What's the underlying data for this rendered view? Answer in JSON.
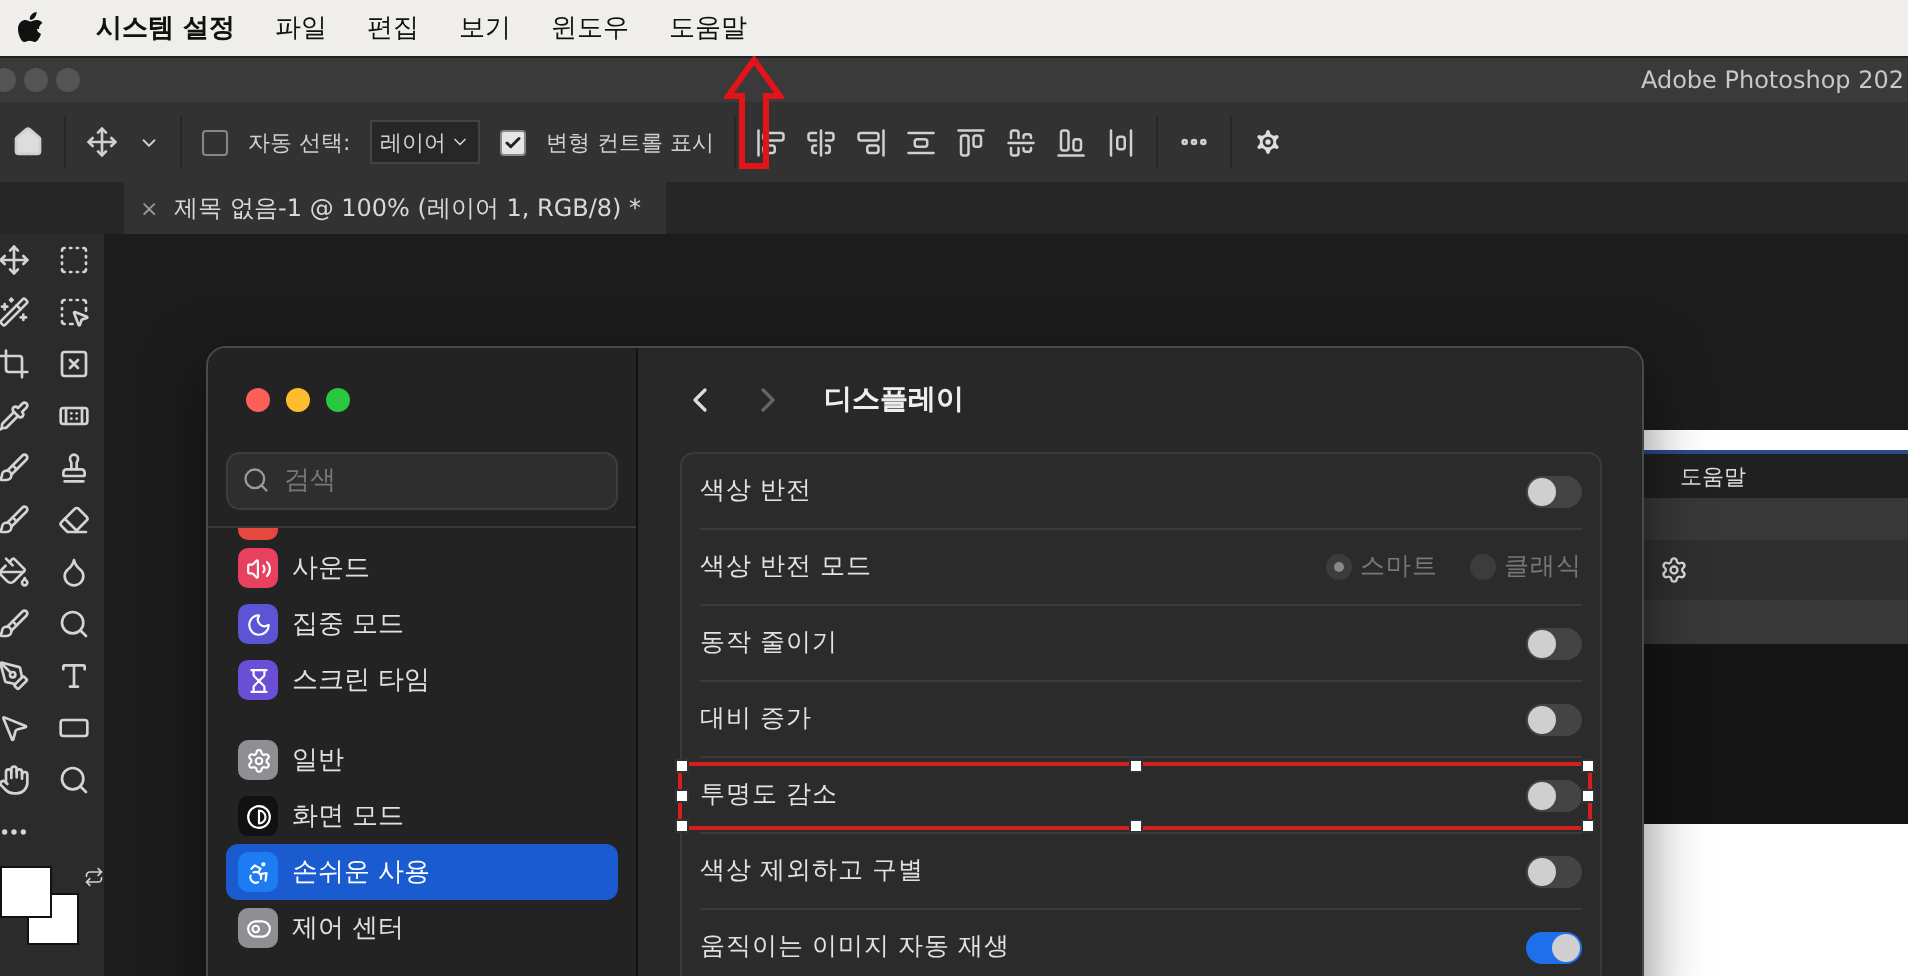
{
  "menubar": {
    "app": "시스템 설정",
    "items": [
      "파일",
      "편집",
      "보기",
      "윈도우",
      "도움말"
    ]
  },
  "photoshop": {
    "title": "Adobe Photoshop 202",
    "auto_select": {
      "label": "자동 선택:",
      "checked": false
    },
    "layer_dropdown": "레이어",
    "show_transform": {
      "label": "변형 컨트롤 표시",
      "checked": true
    },
    "doc_tab": {
      "close": "×",
      "title": "제목 없음-1 @ 100% (레이어 1, RGB/8) *"
    }
  },
  "settings": {
    "search": {
      "placeholder": "검색"
    },
    "sidebar": [
      {
        "items": [
          {
            "kind": "notifications",
            "color": "#e5483f"
          },
          {
            "kind": "sound",
            "label": "사운드",
            "color": "#e8405e",
            "selected": false
          },
          {
            "kind": "focus",
            "label": "집중 모드",
            "color": "#5b55d6",
            "selected": false
          },
          {
            "kind": "screen_time",
            "label": "스크린 타임",
            "color": "#6a4fd6",
            "selected": false
          }
        ]
      },
      {
        "items": [
          {
            "kind": "general",
            "label": "일반",
            "color": "#8e8e93",
            "selected": false
          },
          {
            "kind": "appearance",
            "label": "화면 모드",
            "color": "#111111",
            "selected": false
          },
          {
            "kind": "accessibility",
            "label": "손쉬운 사용",
            "color": "#1e7cf2",
            "selected": true
          },
          {
            "kind": "control_center",
            "label": "제어 센터",
            "color": "#8e8e93",
            "selected": false
          }
        ]
      }
    ],
    "page_title": "디스플레이",
    "rows": [
      {
        "kind": "toggle",
        "label": "색상 반전",
        "on": false
      },
      {
        "kind": "radio",
        "label": "색상 반전 모드",
        "disabled": true,
        "options": [
          {
            "label": "스마트",
            "selected": true
          },
          {
            "label": "클래식",
            "selected": false
          }
        ]
      },
      {
        "kind": "toggle",
        "label": "동작 줄이기",
        "on": false
      },
      {
        "kind": "toggle",
        "label": "대비 증가",
        "on": false
      },
      {
        "kind": "toggle",
        "label": "투명도 감소",
        "on": false,
        "highlighted": true
      },
      {
        "kind": "toggle",
        "label": "색상 제외하고 구별",
        "on": false
      },
      {
        "kind": "toggle",
        "label": "움직이는 이미지 자동 재생",
        "on": true
      }
    ]
  },
  "background_window": {
    "menu_item": "도움말"
  }
}
